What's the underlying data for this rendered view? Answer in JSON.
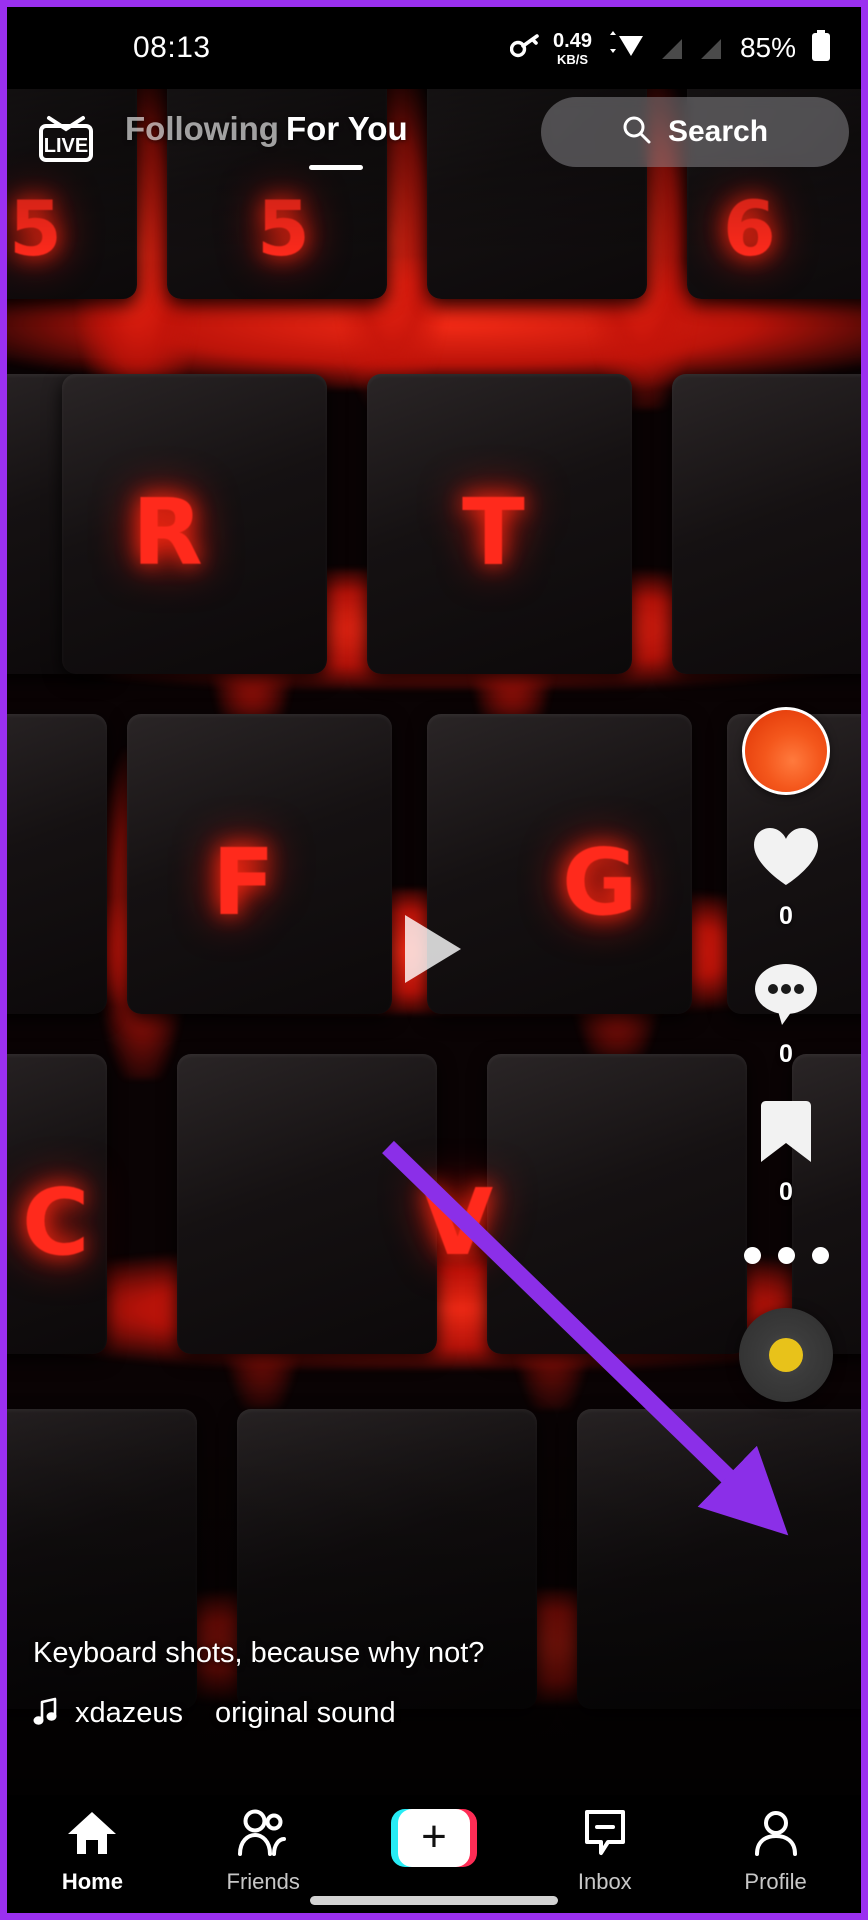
{
  "annotation": {
    "frame_color": "#9b30f0",
    "arrow_color": "#8b2fe8"
  },
  "status_bar": {
    "time": "08:13",
    "net_speed_value": "0.49",
    "net_speed_unit": "KB/S",
    "battery_percent": "85%",
    "icons": [
      "vpn-key-icon",
      "wifi-icon",
      "sim-no-signal-icon",
      "sim-no-signal-icon",
      "battery-icon"
    ]
  },
  "top_nav": {
    "live_label": "LIVE",
    "tabs": [
      {
        "label": "Following",
        "active": false
      },
      {
        "label": "For You",
        "active": true
      }
    ],
    "search_label": "Search",
    "search_icon": "search-icon"
  },
  "video": {
    "play_icon": "play-icon",
    "key_labels": [
      "5",
      "5",
      "6",
      "R",
      "T",
      "F",
      "G",
      "C",
      "V"
    ]
  },
  "action_rail": {
    "avatar_name": "creator-avatar",
    "avatar_color": "#f4571c",
    "actions": [
      {
        "icon": "heart-icon",
        "name": "like-button",
        "count": "0"
      },
      {
        "icon": "comment-icon",
        "name": "comment-button",
        "count": "0"
      },
      {
        "icon": "bookmark-icon",
        "name": "bookmark-button",
        "count": "0"
      }
    ],
    "more_icon": "more-dots-icon",
    "disc_icon": "music-disc-icon",
    "disc_hub_color": "#e8c21a"
  },
  "caption": {
    "text": "Keyboard shots, because why not?",
    "music_icon": "music-note-icon",
    "username": "xdazeus",
    "sound_name": "original sound"
  },
  "bottom_nav": {
    "items": [
      {
        "label": "Home",
        "icon": "home-icon",
        "active": true
      },
      {
        "label": "Friends",
        "icon": "friends-icon",
        "active": false
      },
      {
        "label": "",
        "icon": "create-plus-icon",
        "active": false
      },
      {
        "label": "Inbox",
        "icon": "inbox-icon",
        "active": false
      },
      {
        "label": "Profile",
        "icon": "profile-icon",
        "active": false
      }
    ]
  }
}
